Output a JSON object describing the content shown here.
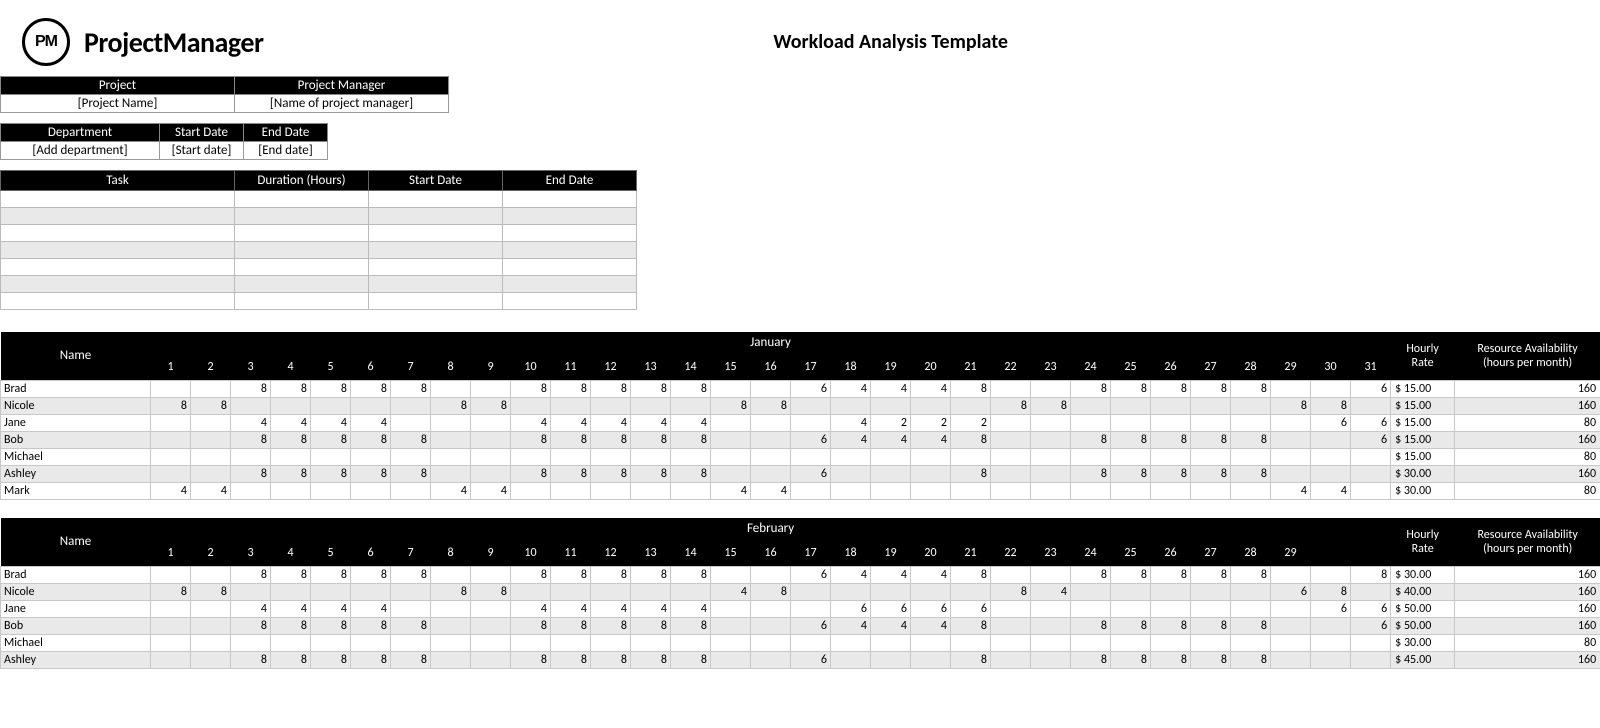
{
  "brand": {
    "abbr": "PM",
    "name": "ProjectManager"
  },
  "doc_title": "Workload Analysis Template",
  "meta1": {
    "headers": [
      "Project",
      "Project Manager"
    ],
    "values": [
      "[Project Name]",
      "[Name of project manager]"
    ]
  },
  "meta2": {
    "headers": [
      "Department",
      "Start Date",
      "End Date"
    ],
    "values": [
      "[Add department]",
      "[Start date]",
      "[End date]"
    ]
  },
  "task_table": {
    "headers": [
      "Task",
      "Duration (Hours)",
      "Start Date",
      "End Date"
    ],
    "row_count": 7
  },
  "side_headers": {
    "name": "Name",
    "rate": "Hourly Rate",
    "avail": "Resource Availability (hours per month)"
  },
  "months": [
    {
      "label": "January",
      "days": 31,
      "rows": [
        {
          "name": "Brad",
          "rate": "$  15.00",
          "avail": "160",
          "cells": {
            "3": 8,
            "4": 8,
            "5": 8,
            "6": 8,
            "7": 8,
            "10": 8,
            "11": 8,
            "12": 8,
            "13": 8,
            "14": 8,
            "17": 6,
            "18": 4,
            "19": 4,
            "20": 4,
            "21": 8,
            "24": 8,
            "25": 8,
            "26": 8,
            "27": 8,
            "28": 8,
            "31": 6
          }
        },
        {
          "name": "Nicole",
          "rate": "$  15.00",
          "avail": "160",
          "cells": {
            "1": 8,
            "2": 8,
            "8": 8,
            "9": 8,
            "15": 8,
            "16": 8,
            "22": 8,
            "23": 8,
            "29": 8,
            "30": 8
          }
        },
        {
          "name": "Jane",
          "rate": "$  15.00",
          "avail": "80",
          "cells": {
            "3": 4,
            "4": 4,
            "5": 4,
            "6": 4,
            "10": 4,
            "11": 4,
            "12": 4,
            "13": 4,
            "14": 4,
            "18": 4,
            "19": 2,
            "20": 2,
            "21": 2,
            "30": 6,
            "31": 6
          }
        },
        {
          "name": "Bob",
          "rate": "$  15.00",
          "avail": "160",
          "cells": {
            "3": 8,
            "4": 8,
            "5": 8,
            "6": 8,
            "7": 8,
            "10": 8,
            "11": 8,
            "12": 8,
            "13": 8,
            "14": 8,
            "17": 6,
            "18": 4,
            "19": 4,
            "20": 4,
            "21": 8,
            "24": 8,
            "25": 8,
            "26": 8,
            "27": 8,
            "28": 8,
            "31": 6
          }
        },
        {
          "name": "Michael",
          "rate": "$  15.00",
          "avail": "80",
          "cells": {}
        },
        {
          "name": "Ashley",
          "rate": "$  30.00",
          "avail": "160",
          "cells": {
            "3": 8,
            "4": 8,
            "5": 8,
            "6": 8,
            "7": 8,
            "10": 8,
            "11": 8,
            "12": 8,
            "13": 8,
            "14": 8,
            "17": 6,
            "21": 8,
            "24": 8,
            "25": 8,
            "26": 8,
            "27": 8,
            "28": 8
          }
        },
        {
          "name": "Mark",
          "rate": "$  30.00",
          "avail": "80",
          "cells": {
            "1": 4,
            "2": 4,
            "8": 4,
            "9": 4,
            "15": 4,
            "16": 4,
            "29": 4,
            "30": 4
          }
        }
      ]
    },
    {
      "label": "February",
      "days": 29,
      "pad": 2,
      "rows": [
        {
          "name": "Brad",
          "rate": "$  30.00",
          "avail": "160",
          "cells": {
            "3": 8,
            "4": 8,
            "5": 8,
            "6": 8,
            "7": 8,
            "10": 8,
            "11": 8,
            "12": 8,
            "13": 8,
            "14": 8,
            "17": 6,
            "18": 4,
            "19": 4,
            "20": 4,
            "21": 8,
            "24": 8,
            "25": 8,
            "26": 8,
            "27": 8,
            "28": 8,
            "31": 8
          }
        },
        {
          "name": "Nicole",
          "rate": "$  40.00",
          "avail": "160",
          "cells": {
            "1": 8,
            "2": 8,
            "8": 8,
            "9": 8,
            "15": 4,
            "16": 8,
            "22": 8,
            "23": 4,
            "29": 6,
            "30": 8
          }
        },
        {
          "name": "Jane",
          "rate": "$  50.00",
          "avail": "160",
          "cells": {
            "3": 4,
            "4": 4,
            "5": 4,
            "6": 4,
            "10": 4,
            "11": 4,
            "12": 4,
            "13": 4,
            "14": 4,
            "18": 6,
            "19": 6,
            "20": 6,
            "21": 6,
            "30": 6,
            "31": 6
          }
        },
        {
          "name": "Bob",
          "rate": "$  50.00",
          "avail": "160",
          "cells": {
            "3": 8,
            "4": 8,
            "5": 8,
            "6": 8,
            "7": 8,
            "10": 8,
            "11": 8,
            "12": 8,
            "13": 8,
            "14": 8,
            "17": 6,
            "18": 4,
            "19": 4,
            "20": 4,
            "21": 8,
            "24": 8,
            "25": 8,
            "26": 8,
            "27": 8,
            "28": 8,
            "31": 6
          }
        },
        {
          "name": "Michael",
          "rate": "$  30.00",
          "avail": "80",
          "cells": {}
        },
        {
          "name": "Ashley",
          "rate": "$  45.00",
          "avail": "160",
          "cells": {
            "3": 8,
            "4": 8,
            "5": 8,
            "6": 8,
            "7": 8,
            "10": 8,
            "11": 8,
            "12": 8,
            "13": 8,
            "14": 8,
            "17": 6,
            "21": 8,
            "24": 8,
            "25": 8,
            "26": 8,
            "27": 8,
            "28": 8
          }
        }
      ]
    }
  ]
}
